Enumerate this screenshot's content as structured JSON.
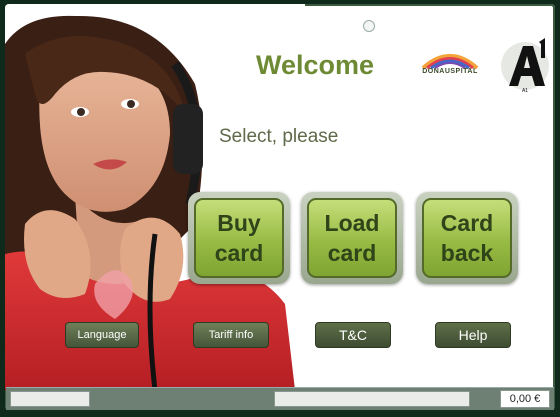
{
  "header": {
    "title": "Welcome",
    "subtitle": "Select, please"
  },
  "logos": {
    "partner_name": "DONAUSPITAL",
    "brand_name": "A1"
  },
  "main_buttons": [
    {
      "label": "Buy\ncard"
    },
    {
      "label": "Load\ncard"
    },
    {
      "label": "Card\nback"
    }
  ],
  "secondary_buttons": [
    {
      "label": "Language"
    },
    {
      "label": "Tariff info"
    },
    {
      "label": "T&C"
    },
    {
      "label": "Help"
    }
  ],
  "status": {
    "amount": "0,00 €"
  },
  "colors": {
    "title_green": "#6f8a35",
    "button_green": "#98bb44",
    "button_dark": "#45553a"
  }
}
